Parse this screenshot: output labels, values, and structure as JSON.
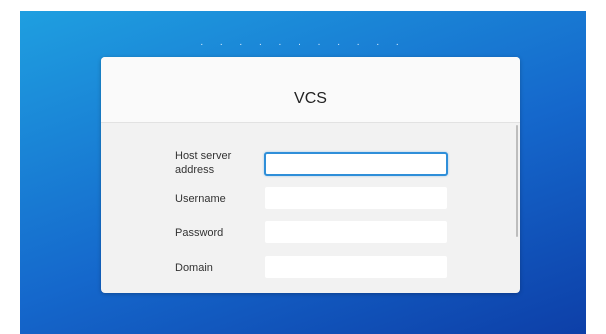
{
  "page_indicator": ". . . . . . . . . . .",
  "dialog": {
    "title": "VCS",
    "fields": [
      {
        "label": "Host server address",
        "value": "",
        "placeholder": ""
      },
      {
        "label": "Username",
        "value": "",
        "placeholder": ""
      },
      {
        "label": "Password",
        "value": "",
        "placeholder": ""
      },
      {
        "label": "Domain",
        "value": "",
        "placeholder": ""
      }
    ]
  },
  "colors": {
    "background_top": "#1f9fe0",
    "background_bottom": "#0d3fa8",
    "focus_ring": "#2f8fd9"
  }
}
